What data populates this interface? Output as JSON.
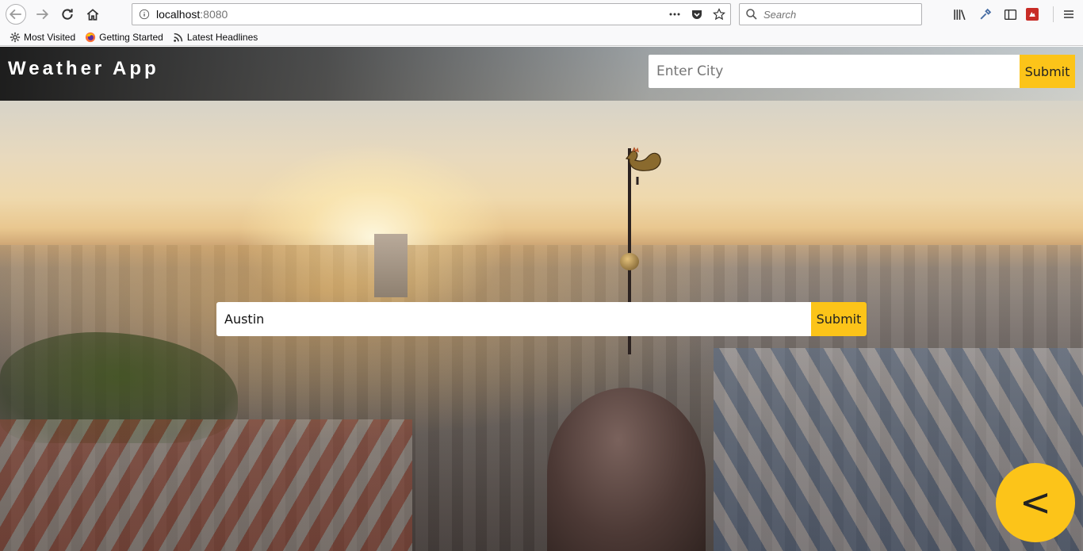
{
  "browser": {
    "url_host": "localhost",
    "url_port": ":8080",
    "search_placeholder": "Search",
    "bookmarks": [
      {
        "label": "Most Visited",
        "icon": "gear-icon"
      },
      {
        "label": "Getting Started",
        "icon": "firefox-icon"
      },
      {
        "label": "Latest Headlines",
        "icon": "rss-icon"
      }
    ]
  },
  "app": {
    "title": "Weather App",
    "header_input_placeholder": "Enter City",
    "header_submit_label": "Submit",
    "center_input_value": "Austin",
    "center_submit_label": "Submit",
    "fab_label": "<"
  },
  "colors": {
    "accent": "#fcc419"
  }
}
